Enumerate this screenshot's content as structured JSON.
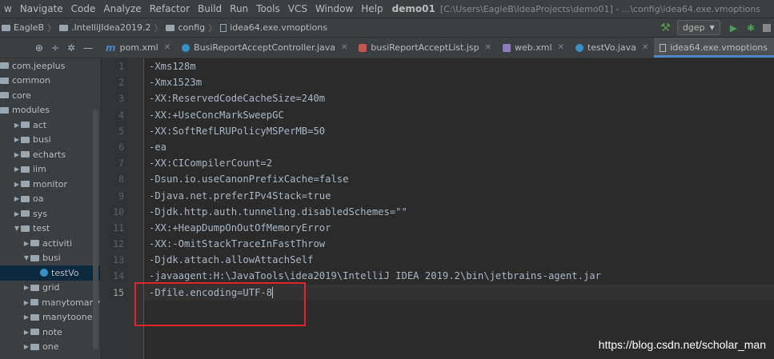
{
  "menu": {
    "items": [
      "w",
      "Navigate",
      "Code",
      "Analyze",
      "Refactor",
      "Build",
      "Run",
      "Tools",
      "VCS",
      "Window",
      "Help"
    ],
    "project": "demo01",
    "path": "[C:\\Users\\EagleB\\IdeaProjects\\demo01] - ...\\config\\idea64.exe.vmoptions"
  },
  "breadcrumb": {
    "items": [
      "EagleB",
      ".IntelliJIdea2019.2",
      "config",
      "idea64.exe.vmoptions"
    ]
  },
  "toolbar": {
    "run_config": "dgep"
  },
  "sidebar": {
    "items": [
      {
        "label": "com.jeeplus",
        "indent": 0,
        "arrow": ""
      },
      {
        "label": "common",
        "indent": 0,
        "arrow": ""
      },
      {
        "label": "core",
        "indent": 0,
        "arrow": ""
      },
      {
        "label": "modules",
        "indent": 0,
        "arrow": ""
      },
      {
        "label": "act",
        "indent": 1,
        "arrow": "▶"
      },
      {
        "label": "busi",
        "indent": 1,
        "arrow": "▶"
      },
      {
        "label": "echarts",
        "indent": 1,
        "arrow": "▶"
      },
      {
        "label": "iim",
        "indent": 1,
        "arrow": "▶"
      },
      {
        "label": "monitor",
        "indent": 1,
        "arrow": "▶"
      },
      {
        "label": "oa",
        "indent": 1,
        "arrow": "▶"
      },
      {
        "label": "sys",
        "indent": 1,
        "arrow": "▶"
      },
      {
        "label": "test",
        "indent": 1,
        "arrow": "▼"
      },
      {
        "label": "activiti",
        "indent": 2,
        "arrow": "▶"
      },
      {
        "label": "busi",
        "indent": 2,
        "arrow": "▼"
      },
      {
        "label": "testVo",
        "indent": 3,
        "arrow": "",
        "type": "class",
        "selected": true
      },
      {
        "label": "grid",
        "indent": 2,
        "arrow": "▶"
      },
      {
        "label": "manytomany",
        "indent": 2,
        "arrow": "▶"
      },
      {
        "label": "manytoone",
        "indent": 2,
        "arrow": "▶"
      },
      {
        "label": "note",
        "indent": 2,
        "arrow": "▶"
      },
      {
        "label": "one",
        "indent": 2,
        "arrow": "▶"
      }
    ]
  },
  "tabs": [
    {
      "label": "pom.xml",
      "icon": "maven-icon",
      "active": false
    },
    {
      "label": "BusiReportAcceptController.java",
      "icon": "class-icon",
      "active": false
    },
    {
      "label": "busiReportAcceptList.jsp",
      "icon": "jsp-icon",
      "active": false
    },
    {
      "label": "web.xml",
      "icon": "xml-icon",
      "active": false
    },
    {
      "label": "testVo.java",
      "icon": "class-icon",
      "active": false
    },
    {
      "label": "idea64.exe.vmoptions",
      "icon": "file-icon",
      "active": true
    }
  ],
  "editor": {
    "current_line": 15,
    "lines": [
      "-Xms128m",
      "-Xmx1523m",
      "-XX:ReservedCodeCacheSize=240m",
      "-XX:+UseConcMarkSweepGC",
      "-XX:SoftRefLRUPolicyMSPerMB=50",
      "-ea",
      "-XX:CICompilerCount=2",
      "-Dsun.io.useCanonPrefixCache=false",
      "-Djava.net.preferIPv4Stack=true",
      "-Djdk.http.auth.tunneling.disabledSchemes=\"\"",
      "-XX:+HeapDumpOnOutOfMemoryError",
      "-XX:-OmitStackTraceInFastThrow",
      "-Djdk.attach.allowAttachSelf",
      "-javaagent:H:\\JavaTools\\idea2019\\IntelliJ IDEA 2019.2\\bin\\jetbrains-agent.jar",
      "-Dfile.encoding=UTF-8"
    ]
  },
  "watermark": "https://blog.csdn.net/scholar_man",
  "colors": {
    "highlight_box": "#e3242b",
    "active_tab_underline": "#4a88c7"
  }
}
